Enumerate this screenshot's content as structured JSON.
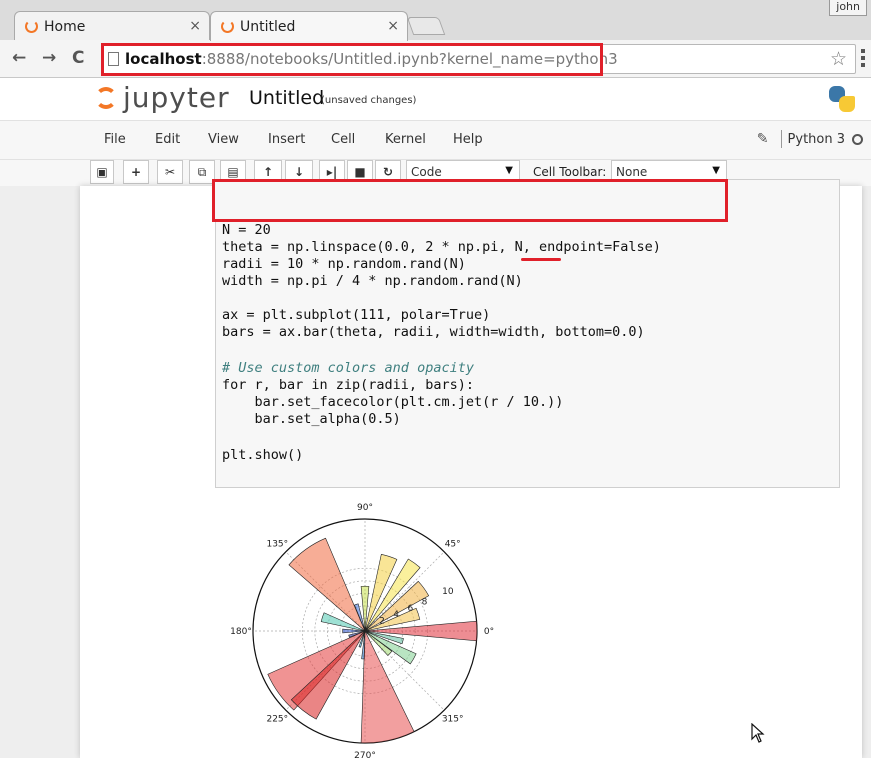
{
  "browser": {
    "tabs": [
      {
        "label": "Home",
        "close": "×"
      },
      {
        "label": "Untitled",
        "close": "×"
      }
    ],
    "user": "john",
    "url_host": "localhost",
    "url_path": ":8888/notebooks/Untitled.ipynb?kernel_name=python3",
    "nav": {
      "back": "←",
      "forward": "→",
      "reload": "C"
    },
    "star": "☆"
  },
  "jupyter": {
    "logo_text": "jupyter",
    "notebook_name": "Untitled",
    "save_status": "(unsaved changes)",
    "menu": [
      "File",
      "Edit",
      "View",
      "Insert",
      "Cell",
      "Kernel",
      "Help"
    ],
    "kernel_name": "Python 3",
    "cell_type": "Code",
    "cell_toolbar_label": "Cell Toolbar:",
    "cell_toolbar_value": "None",
    "toolbar_icons": [
      "save-icon",
      "add-icon",
      "cut-icon",
      "copy-icon",
      "paste-icon",
      "move-up-icon",
      "move-down-icon",
      "run-icon",
      "stop-icon",
      "restart-icon"
    ]
  },
  "code": {
    "line1": "N = 20",
    "line2": "theta = np.linspace(0.0, 2 * np.pi, N, endpoint=False)",
    "line3": "radii = 10 * np.random.rand(N)",
    "line4": "width = np.pi / 4 * np.random.rand(N)",
    "line5": "ax = plt.subplot(111, polar=True)",
    "line6": "bars = ax.bar(theta, radii, width=width, bottom=0.0)",
    "line7": "# Use custom colors and opacity",
    "line8": "for r, bar in zip(radii, bars):",
    "line9": "    bar.set_facecolor(plt.cm.jet(r / 10.))",
    "line10": "    bar.set_alpha(0.5)",
    "line11": "plt.show()"
  },
  "chart_data": {
    "type": "polar-bar",
    "angle_ticks": [
      "0°",
      "45°",
      "90°",
      "135°",
      "180°",
      "225°",
      "270°",
      "315°"
    ],
    "radial_ticks": [
      "2",
      "4",
      "6",
      "8",
      "10"
    ],
    "rmax": 10,
    "bars": [
      {
        "theta_deg": 0,
        "width_deg": 10,
        "r": 10.0,
        "color": "#e0303a"
      },
      {
        "theta_deg": 18,
        "width_deg": 12,
        "r": 5.0,
        "color": "#f3c24a"
      },
      {
        "theta_deg": 36,
        "width_deg": 14,
        "r": 6.5,
        "color": "#f0b040"
      },
      {
        "theta_deg": 54,
        "width_deg": 10,
        "r": 7.5,
        "color": "#f6e34a"
      },
      {
        "theta_deg": 72,
        "width_deg": 12,
        "r": 7.0,
        "color": "#f4d03f"
      },
      {
        "theta_deg": 90,
        "width_deg": 10,
        "r": 4.0,
        "color": "#c7e04a"
      },
      {
        "theta_deg": 108,
        "width_deg": 8,
        "r": 2.5,
        "color": "#3a70d8"
      },
      {
        "theta_deg": 126,
        "width_deg": 26,
        "r": 9.0,
        "color": "#f06a40"
      },
      {
        "theta_deg": 162,
        "width_deg": 12,
        "r": 4.0,
        "color": "#4ec9b0"
      },
      {
        "theta_deg": 180,
        "width_deg": 10,
        "r": 2.0,
        "color": "#2850c8"
      },
      {
        "theta_deg": 198,
        "width_deg": 8,
        "r": 1.5,
        "color": "#1a2aa0"
      },
      {
        "theta_deg": 216,
        "width_deg": 24,
        "r": 9.5,
        "color": "#e43a3a"
      },
      {
        "theta_deg": 232,
        "width_deg": 18,
        "r": 9.0,
        "color": "#d82020"
      },
      {
        "theta_deg": 252,
        "width_deg": 6,
        "r": 1.5,
        "color": "#30a0e0"
      },
      {
        "theta_deg": 266,
        "width_deg": 6,
        "r": 2.5,
        "color": "#2a7ad0"
      },
      {
        "theta_deg": 282,
        "width_deg": 28,
        "r": 10.0,
        "color": "#e85050"
      },
      {
        "theta_deg": 318,
        "width_deg": 10,
        "r": 3.0,
        "color": "#a0d870"
      },
      {
        "theta_deg": 330,
        "width_deg": 12,
        "r": 5.0,
        "color": "#7fd090"
      },
      {
        "theta_deg": 345,
        "width_deg": 8,
        "r": 3.5,
        "color": "#5cc0a0"
      }
    ]
  }
}
